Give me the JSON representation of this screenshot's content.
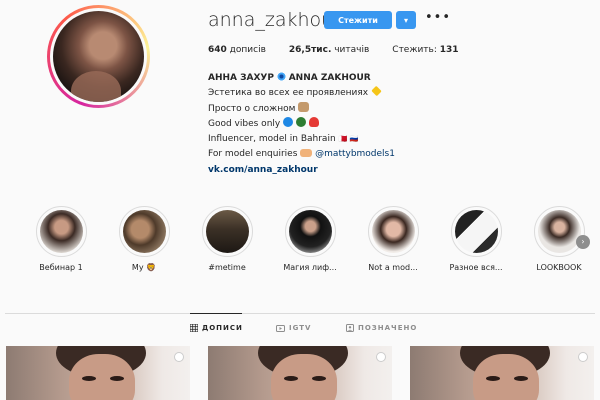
{
  "profile": {
    "username": "anna_zakhour",
    "follow_label": "Стежити",
    "dropdown_icon": "▾",
    "more_icon": "•••",
    "stats": {
      "posts_count": "640",
      "posts_label": " дописів",
      "followers_count": "26,5тис.",
      "followers_label": " читачів",
      "following_label": "Стежить: ",
      "following_count": "131"
    },
    "bio": {
      "name": "АННА ЗАХУР",
      "name_latin": "ANNA ZAKHOUR",
      "line1": "Эстетика во всех ее проявлениях",
      "line2": "Просто о сложном",
      "line3": "Good vibes only",
      "line4": "Influencer, model in Bahrain ",
      "line4_flags": "🇧🇭 🇷🇺",
      "line5": "For model enquiries",
      "mention": "@mattybmodels1",
      "link": "vk.com/anna_zakhour"
    }
  },
  "highlights": [
    {
      "label": "Вебинар 1"
    },
    {
      "label": "My 🦁"
    },
    {
      "label": "#metime"
    },
    {
      "label": "Магия лиф..."
    },
    {
      "label": "Not a mod..."
    },
    {
      "label": "Разное вся..."
    },
    {
      "label": "LOOKBOOK"
    }
  ],
  "tabs": [
    {
      "label": "ДОПИСИ",
      "icon": "grid-icon"
    },
    {
      "label": "IGTV",
      "icon": "tv-icon"
    },
    {
      "label": "ПОЗНАЧЕНО",
      "icon": "tagged-icon"
    }
  ],
  "colors": {
    "accent": "#3897f0",
    "link": "#00376b",
    "text": "#262626",
    "muted": "#8e8e8e"
  }
}
